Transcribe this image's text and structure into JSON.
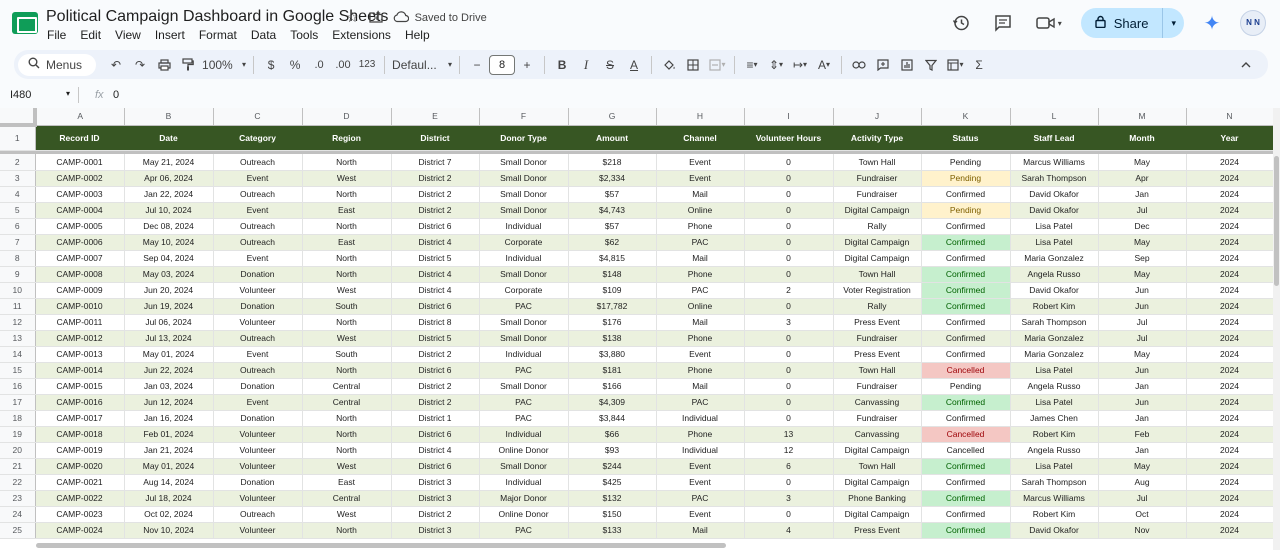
{
  "title": "Political Campaign Dashboard in Google Sheets",
  "saved_status": "Saved to Drive",
  "menu": [
    "File",
    "Edit",
    "View",
    "Insert",
    "Format",
    "Data",
    "Tools",
    "Extensions",
    "Help"
  ],
  "share_label": "Share",
  "avatar_text": "N N",
  "toolbar": {
    "menus_label": "Menus",
    "zoom": "100%",
    "currency": "$",
    "percent": "%",
    "dec_decrease": ".0",
    "dec_increase": ".00",
    "number_format": "123",
    "font": "Defaul...",
    "font_size": "8"
  },
  "formula_bar": {
    "cell_ref": "I480",
    "fx": "fx",
    "value": "0"
  },
  "columns": [
    "A",
    "B",
    "C",
    "D",
    "E",
    "F",
    "G",
    "H",
    "I",
    "J",
    "K",
    "L",
    "M",
    "N"
  ],
  "selected_column": "I",
  "headers": [
    "Record ID",
    "Date",
    "Category",
    "Region",
    "District",
    "Donor Type",
    "Amount",
    "Channel",
    "Volunteer Hours",
    "Activity Type",
    "Status",
    "Staff Lead",
    "Month",
    "Year"
  ],
  "rows": [
    [
      "CAMP-0001",
      "May 21, 2024",
      "Outreach",
      "North",
      "District 7",
      "Small Donor",
      "$218",
      "Event",
      "0",
      "Town Hall",
      "Pending",
      "Marcus Williams",
      "May",
      "2024"
    ],
    [
      "CAMP-0002",
      "Apr 06, 2024",
      "Event",
      "West",
      "District 2",
      "Small Donor",
      "$2,334",
      "Event",
      "0",
      "Fundraiser",
      "Pending",
      "Sarah Thompson",
      "Apr",
      "2024"
    ],
    [
      "CAMP-0003",
      "Jan 22, 2024",
      "Outreach",
      "North",
      "District 2",
      "Small Donor",
      "$57",
      "Mail",
      "0",
      "Fundraiser",
      "Confirmed",
      "David Okafor",
      "Jan",
      "2024"
    ],
    [
      "CAMP-0004",
      "Jul 10, 2024",
      "Event",
      "East",
      "District 2",
      "Small Donor",
      "$4,743",
      "Online",
      "0",
      "Digital Campaign",
      "Pending",
      "David Okafor",
      "Jul",
      "2024"
    ],
    [
      "CAMP-0005",
      "Dec 08, 2024",
      "Outreach",
      "North",
      "District 6",
      "Individual",
      "$57",
      "Phone",
      "0",
      "Rally",
      "Confirmed",
      "Lisa Patel",
      "Dec",
      "2024"
    ],
    [
      "CAMP-0006",
      "May 10, 2024",
      "Outreach",
      "East",
      "District 4",
      "Corporate",
      "$62",
      "PAC",
      "0",
      "Digital Campaign",
      "Confirmed",
      "Lisa Patel",
      "May",
      "2024"
    ],
    [
      "CAMP-0007",
      "Sep 04, 2024",
      "Event",
      "North",
      "District 5",
      "Individual",
      "$4,815",
      "Mail",
      "0",
      "Digital Campaign",
      "Confirmed",
      "Maria Gonzalez",
      "Sep",
      "2024"
    ],
    [
      "CAMP-0008",
      "May 03, 2024",
      "Donation",
      "North",
      "District 4",
      "Small Donor",
      "$148",
      "Phone",
      "0",
      "Town Hall",
      "Confirmed",
      "Angela Russo",
      "May",
      "2024"
    ],
    [
      "CAMP-0009",
      "Jun 20, 2024",
      "Volunteer",
      "West",
      "District 4",
      "Corporate",
      "$109",
      "PAC",
      "2",
      "Voter Registration",
      "Confirmed",
      "David Okafor",
      "Jun",
      "2024"
    ],
    [
      "CAMP-0010",
      "Jun 19, 2024",
      "Donation",
      "South",
      "District 6",
      "PAC",
      "$17,782",
      "Online",
      "0",
      "Rally",
      "Confirmed",
      "Robert Kim",
      "Jun",
      "2024"
    ],
    [
      "CAMP-0011",
      "Jul 06, 2024",
      "Volunteer",
      "North",
      "District 8",
      "Small Donor",
      "$176",
      "Mail",
      "3",
      "Press Event",
      "Confirmed",
      "Sarah Thompson",
      "Jul",
      "2024"
    ],
    [
      "CAMP-0012",
      "Jul 13, 2024",
      "Outreach",
      "West",
      "District 5",
      "Small Donor",
      "$138",
      "Phone",
      "0",
      "Fundraiser",
      "Confirmed",
      "Maria Gonzalez",
      "Jul",
      "2024"
    ],
    [
      "CAMP-0013",
      "May 01, 2024",
      "Event",
      "South",
      "District 2",
      "Individual",
      "$3,880",
      "Event",
      "0",
      "Press Event",
      "Confirmed",
      "Maria Gonzalez",
      "May",
      "2024"
    ],
    [
      "CAMP-0014",
      "Jun 22, 2024",
      "Outreach",
      "North",
      "District 6",
      "PAC",
      "$181",
      "Phone",
      "0",
      "Town Hall",
      "Cancelled",
      "Lisa Patel",
      "Jun",
      "2024"
    ],
    [
      "CAMP-0015",
      "Jan 03, 2024",
      "Donation",
      "Central",
      "District 2",
      "Small Donor",
      "$166",
      "Mail",
      "0",
      "Fundraiser",
      "Pending",
      "Angela Russo",
      "Jan",
      "2024"
    ],
    [
      "CAMP-0016",
      "Jun 12, 2024",
      "Event",
      "Central",
      "District 2",
      "PAC",
      "$4,309",
      "PAC",
      "0",
      "Canvassing",
      "Confirmed",
      "Lisa Patel",
      "Jun",
      "2024"
    ],
    [
      "CAMP-0017",
      "Jan 16, 2024",
      "Donation",
      "North",
      "District 1",
      "PAC",
      "$3,844",
      "Individual",
      "0",
      "Fundraiser",
      "Confirmed",
      "James Chen",
      "Jan",
      "2024"
    ],
    [
      "CAMP-0018",
      "Feb 01, 2024",
      "Volunteer",
      "North",
      "District 6",
      "Individual",
      "$66",
      "Phone",
      "13",
      "Canvassing",
      "Cancelled",
      "Robert Kim",
      "Feb",
      "2024"
    ],
    [
      "CAMP-0019",
      "Jan 21, 2024",
      "Volunteer",
      "North",
      "District 4",
      "Online Donor",
      "$93",
      "Individual",
      "12",
      "Digital Campaign",
      "Cancelled",
      "Angela Russo",
      "Jan",
      "2024"
    ],
    [
      "CAMP-0020",
      "May 01, 2024",
      "Volunteer",
      "West",
      "District 6",
      "Small Donor",
      "$244",
      "Event",
      "6",
      "Town Hall",
      "Confirmed",
      "Lisa Patel",
      "May",
      "2024"
    ],
    [
      "CAMP-0021",
      "Aug 14, 2024",
      "Donation",
      "East",
      "District 3",
      "Individual",
      "$425",
      "Event",
      "0",
      "Digital Campaign",
      "Confirmed",
      "Sarah Thompson",
      "Aug",
      "2024"
    ],
    [
      "CAMP-0022",
      "Jul 18, 2024",
      "Volunteer",
      "Central",
      "District 3",
      "Major Donor",
      "$132",
      "PAC",
      "3",
      "Phone Banking",
      "Confirmed",
      "Marcus Williams",
      "Jul",
      "2024"
    ],
    [
      "CAMP-0023",
      "Oct 02, 2024",
      "Outreach",
      "West",
      "District 2",
      "Online Donor",
      "$150",
      "Event",
      "0",
      "Digital Campaign",
      "Confirmed",
      "Robert Kim",
      "Oct",
      "2024"
    ],
    [
      "CAMP-0024",
      "Nov 10, 2024",
      "Volunteer",
      "North",
      "District 3",
      "PAC",
      "$133",
      "Mail",
      "4",
      "Press Event",
      "Confirmed",
      "David Okafor",
      "Nov",
      "2024"
    ]
  ],
  "status_fill": [
    "none",
    "yellow",
    "none",
    "yellow",
    "none",
    "green",
    "none",
    "green",
    "green",
    "green",
    "none",
    "none",
    "none",
    "red",
    "none",
    "green",
    "none",
    "red",
    "none",
    "green",
    "none",
    "green",
    "none",
    "green"
  ],
  "colors": {
    "header_bg": "#375623",
    "band_bg": "#ebf1de",
    "pending_fill": "#fff2cc",
    "confirmed_fill": "#c6efce",
    "cancelled_fill": "#f4c7c3",
    "share_bg": "#c2e7ff",
    "toolbar_bg": "#edf2fa"
  }
}
